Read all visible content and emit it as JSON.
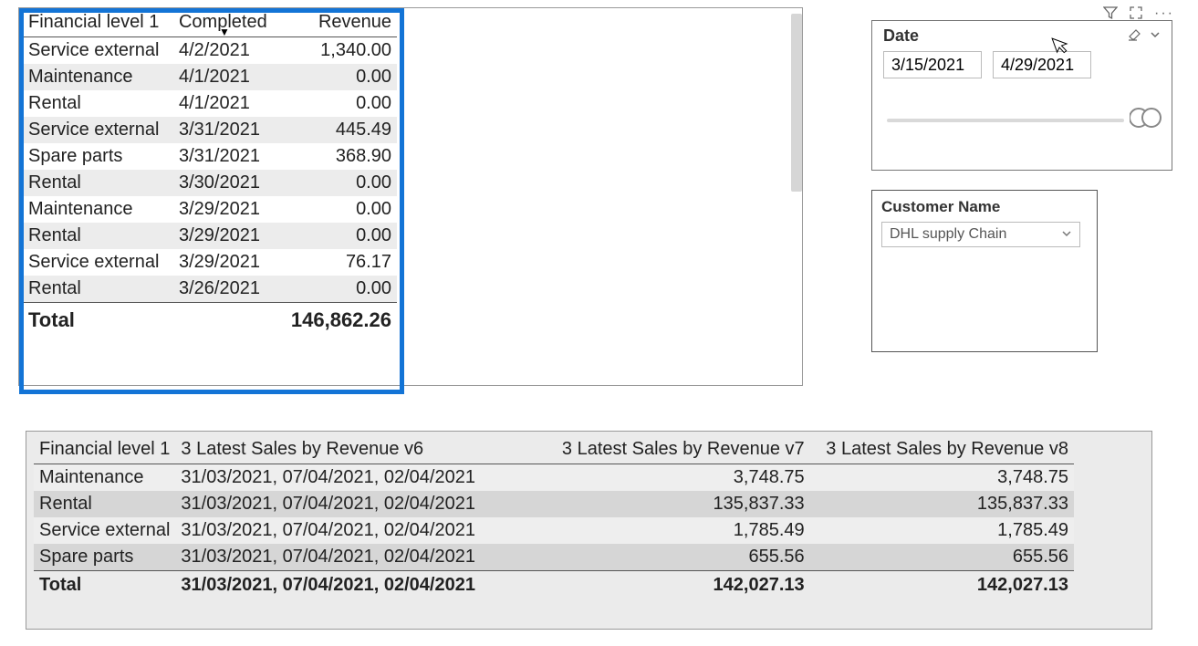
{
  "table1": {
    "headers": [
      "Financial level 1",
      "Completed",
      "Revenue"
    ],
    "rows": [
      {
        "fl1": "Service external",
        "completed": "4/2/2021",
        "revenue": "1,340.00"
      },
      {
        "fl1": "Maintenance",
        "completed": "4/1/2021",
        "revenue": "0.00"
      },
      {
        "fl1": "Rental",
        "completed": "4/1/2021",
        "revenue": "0.00"
      },
      {
        "fl1": "Service external",
        "completed": "3/31/2021",
        "revenue": "445.49"
      },
      {
        "fl1": "Spare parts",
        "completed": "3/31/2021",
        "revenue": "368.90"
      },
      {
        "fl1": "Rental",
        "completed": "3/30/2021",
        "revenue": "0.00"
      },
      {
        "fl1": "Maintenance",
        "completed": "3/29/2021",
        "revenue": "0.00"
      },
      {
        "fl1": "Rental",
        "completed": "3/29/2021",
        "revenue": "0.00"
      },
      {
        "fl1": "Service external",
        "completed": "3/29/2021",
        "revenue": "76.17"
      },
      {
        "fl1": "Rental",
        "completed": "3/26/2021",
        "revenue": "0.00"
      }
    ],
    "total_label": "Total",
    "total_value": "146,862.26"
  },
  "date_slicer": {
    "title": "Date",
    "from": "3/15/2021",
    "to": "4/29/2021"
  },
  "customer_slicer": {
    "title": "Customer Name",
    "selected": "DHL supply Chain"
  },
  "table2": {
    "headers": [
      "Financial level 1",
      "3 Latest Sales by Revenue v6",
      "3 Latest Sales by Revenue v7",
      "3 Latest Sales by Revenue v8"
    ],
    "rows": [
      {
        "fl1": "Maintenance",
        "v6": "31/03/2021, 07/04/2021, 02/04/2021",
        "v7": "3,748.75",
        "v8": "3,748.75"
      },
      {
        "fl1": "Rental",
        "v6": "31/03/2021, 07/04/2021, 02/04/2021",
        "v7": "135,837.33",
        "v8": "135,837.33"
      },
      {
        "fl1": "Service external",
        "v6": "31/03/2021, 07/04/2021, 02/04/2021",
        "v7": "1,785.49",
        "v8": "1,785.49"
      },
      {
        "fl1": "Spare parts",
        "v6": "31/03/2021, 07/04/2021, 02/04/2021",
        "v7": "655.56",
        "v8": "655.56"
      }
    ],
    "total": {
      "label": "Total",
      "v6": "31/03/2021, 07/04/2021, 02/04/2021",
      "v7": "142,027.13",
      "v8": "142,027.13"
    }
  },
  "visual_header_icons": {
    "filter": "filter-icon",
    "focus": "focus-mode-icon",
    "more": "more-options-icon"
  }
}
